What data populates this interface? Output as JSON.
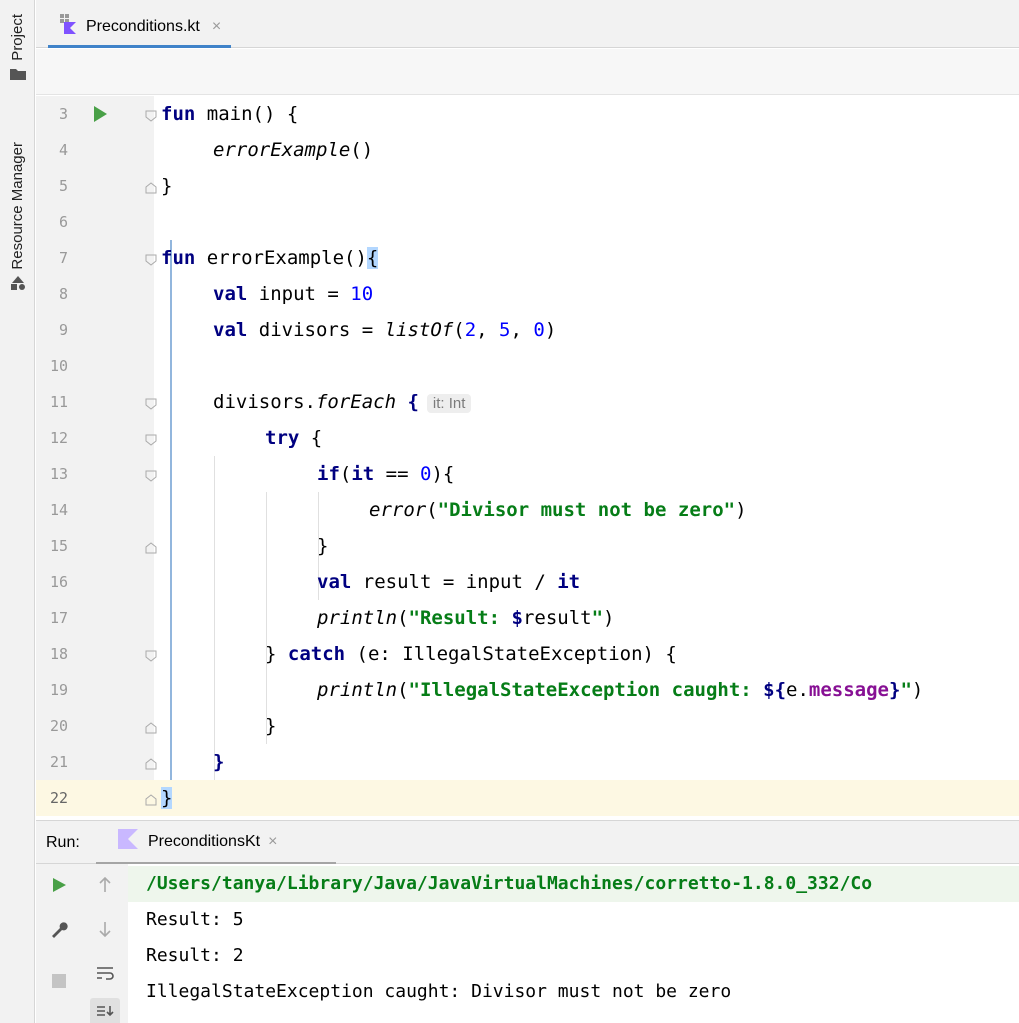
{
  "sidebar": {
    "project_label": "Project",
    "resource_manager_label": "Resource Manager"
  },
  "editor_tab": {
    "filename": "Preconditions.kt",
    "close": "×"
  },
  "code_lines": [
    {
      "n": "3"
    },
    {
      "n": "4"
    },
    {
      "n": "5"
    },
    {
      "n": "6"
    },
    {
      "n": "7"
    },
    {
      "n": "8"
    },
    {
      "n": "9"
    },
    {
      "n": "10"
    },
    {
      "n": "11"
    },
    {
      "n": "12"
    },
    {
      "n": "13"
    },
    {
      "n": "14"
    },
    {
      "n": "15"
    },
    {
      "n": "16"
    },
    {
      "n": "17"
    },
    {
      "n": "18"
    },
    {
      "n": "19"
    },
    {
      "n": "20"
    },
    {
      "n": "21"
    },
    {
      "n": "22"
    }
  ],
  "code": {
    "l3": {
      "kw": "fun",
      "rest": " main() {"
    },
    "l4": {
      "fn": "errorExample",
      "rest": "()"
    },
    "l5": {
      "rest": "}"
    },
    "l7": {
      "kw": "fun",
      "rest": " errorExample()",
      "brace": "{"
    },
    "l8": {
      "kw": "val",
      "rest": " input = ",
      "num": "10"
    },
    "l9": {
      "kw": "val",
      "rest": " divisors = ",
      "fn": "listOf",
      "open": "(",
      "n1": "2",
      "c1": ", ",
      "n2": "5",
      "c2": ", ",
      "n3": "0",
      "close": ")"
    },
    "l11": {
      "pre": "divisors.",
      "fn": "forEach",
      "brace": " {",
      "hint": "it: Int"
    },
    "l12": {
      "kw": "try",
      "rest": " {"
    },
    "l13": {
      "kw": "if",
      "open": "(",
      "kw2": "it",
      "op": " == ",
      "num": "0",
      "rest": "){"
    },
    "l14": {
      "fn": "error",
      "open": "(",
      "str": "\"Divisor must not be zero\"",
      "close": ")"
    },
    "l15": {
      "rest": "}"
    },
    "l16": {
      "kw": "val",
      "rest": " result = input / ",
      "kw2": "it"
    },
    "l17": {
      "fn": "println",
      "open": "(",
      "str1": "\"Result: ",
      "tmpl": "$",
      "str2": "result",
      "str3": "\"",
      "close": ")"
    },
    "l18": {
      "pre": "} ",
      "kw": "catch",
      "rest": " (e: IllegalStateException) {"
    },
    "l19": {
      "fn": "println",
      "open": "(",
      "str1": "\"IllegalStateException caught: ",
      "tmpl": "${",
      "mid": "e.",
      "prop": "message",
      "tmpl2": "}",
      "str2": "\"",
      "close": ")"
    },
    "l20": {
      "rest": "}"
    },
    "l21": {
      "rest": "}"
    },
    "l22": {
      "rest": "}"
    }
  },
  "run_panel": {
    "label": "Run:",
    "tab_label": "PreconditionsKt",
    "close": "×",
    "console": [
      "/Users/tanya/Library/Java/JavaVirtualMachines/corretto-1.8.0_332/Co",
      "Result: 5",
      "Result: 2",
      "IllegalStateException caught: Divisor must not be zero"
    ]
  },
  "colors": {
    "keyword": "#000080",
    "number": "#0000ff",
    "string": "#067d17",
    "property": "#871094",
    "run_green": "#49a047",
    "current_line": "#fdf8e3",
    "tab_underline": "#4083c9"
  },
  "icons": [
    "folder-icon",
    "kotlin-file-icon",
    "resource-manager-icon",
    "run-gutter-icon",
    "fold-icon",
    "rerun-icon",
    "wrench-icon",
    "stop-icon",
    "up-arrow-icon",
    "down-arrow-icon",
    "soft-wrap-icon",
    "scroll-to-end-icon"
  ]
}
